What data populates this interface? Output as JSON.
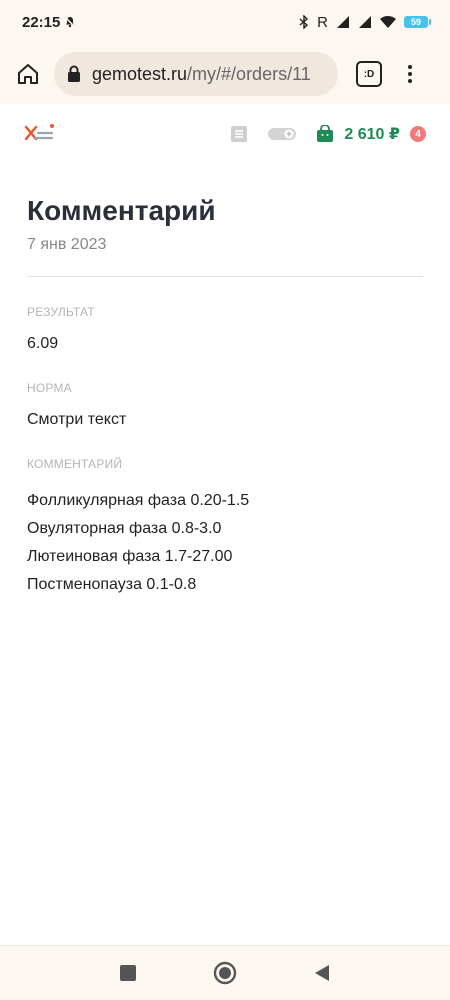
{
  "status_bar": {
    "time": "22:15",
    "carrier_indicator": "R",
    "battery": "59"
  },
  "browser": {
    "url_host": "gemotest.ru",
    "url_path": "/my/#/orders/11",
    "tab_label": ":D"
  },
  "header": {
    "cart_amount": "2 610 ₽",
    "cart_badge": "4"
  },
  "main": {
    "title": "Комментарий",
    "date": "7 янв 2023",
    "sections": {
      "result": {
        "label": "РЕЗУЛЬТАТ",
        "value": "6.09"
      },
      "norm": {
        "label": "НОРМА",
        "value": "Смотри текст"
      },
      "comment": {
        "label": "КОММЕНТАРИЙ",
        "lines": [
          "Фолликулярная фаза 0.20-1.5",
          "Овуляторная фаза 0.8-3.0",
          "Лютеиновая фаза 1.7-27.00",
          "Постменопауза 0.1-0.8"
        ]
      }
    }
  },
  "colors": {
    "accent_green": "#1f8a56",
    "badge_red": "#f07a7a",
    "logo_orange": "#e8572a"
  }
}
